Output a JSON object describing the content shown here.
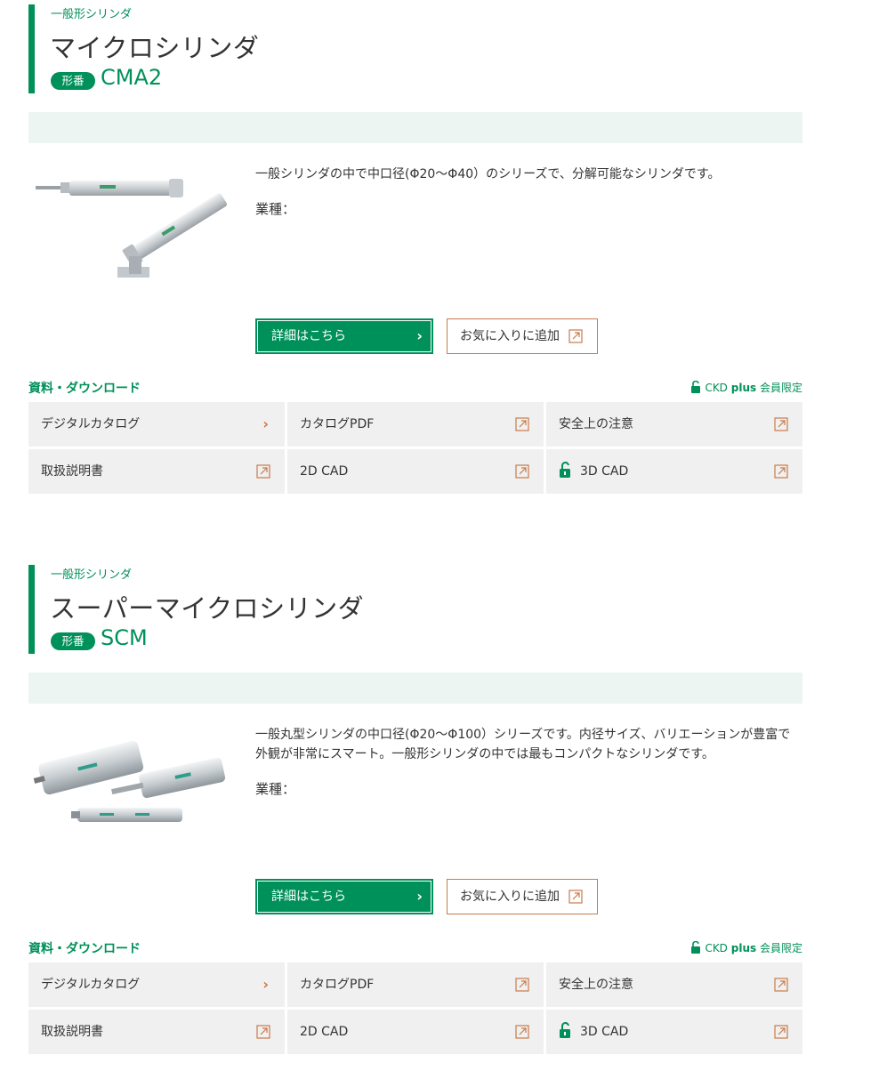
{
  "products": [
    {
      "category": "一般形シリンダ",
      "name": "マイクロシリンダ",
      "model_badge": "形番",
      "model": "CMA2",
      "description": "一般シリンダの中で中口径(Φ20～Φ40）のシリーズで、分解可能なシリンダです。",
      "industry_label": "業種：",
      "photo": "micro-cylinder-photo",
      "detail_button": "詳細はこちら",
      "favorite_button": "お気に入りに追加",
      "downloads_title": "資料・ダウンロード",
      "member_note": {
        "brand": "CKD",
        "plus": "plus",
        "suffix": "会員限定"
      },
      "downloads": [
        {
          "label": "デジタルカタログ",
          "icon": "chevron-right-icon"
        },
        {
          "label": "カタログPDF",
          "icon": "external-link-icon"
        },
        {
          "label": "安全上の注意",
          "icon": "external-link-icon"
        },
        {
          "label": "取扱説明書",
          "icon": "external-link-icon"
        },
        {
          "label": "2D CAD",
          "icon": "external-link-icon"
        },
        {
          "label": "3D CAD",
          "icon": "external-link-icon",
          "locked": true
        }
      ]
    },
    {
      "category": "一般形シリンダ",
      "name": "スーパーマイクロシリンダ",
      "model_badge": "形番",
      "model": "SCM",
      "description": "一般丸型シリンダの中口径(Φ20～Φ100）シリーズです。内径サイズ、バリエーションが豊富で外観が非常にスマート。一般形シリンダの中では最もコンパクトなシリンダです。",
      "industry_label": "業種：",
      "photo": "super-micro-cylinder-photo",
      "detail_button": "詳細はこちら",
      "favorite_button": "お気に入りに追加",
      "downloads_title": "資料・ダウンロード",
      "member_note": {
        "brand": "CKD",
        "plus": "plus",
        "suffix": "会員限定"
      },
      "downloads": [
        {
          "label": "デジタルカタログ",
          "icon": "chevron-right-icon"
        },
        {
          "label": "カタログPDF",
          "icon": "external-link-icon"
        },
        {
          "label": "安全上の注意",
          "icon": "external-link-icon"
        },
        {
          "label": "取扱説明書",
          "icon": "external-link-icon"
        },
        {
          "label": "2D CAD",
          "icon": "external-link-icon"
        },
        {
          "label": "3D CAD",
          "icon": "external-link-icon",
          "locked": true
        }
      ]
    }
  ],
  "colors": {
    "brand_green": "#00905a",
    "accent_orange": "#c87a4a",
    "band": "#edf5f2",
    "cell_bg": "#f0f0f0"
  }
}
